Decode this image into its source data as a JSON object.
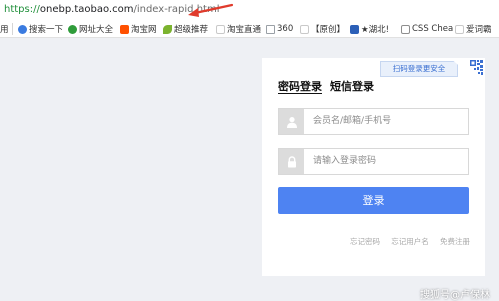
{
  "address_bar": {
    "scheme": "https://",
    "host": "onebp.taobao.com",
    "path": "/index-rapid.html"
  },
  "bookmarks": [
    {
      "label": "用",
      "icon": "apps-icon",
      "color": "#5f6368"
    },
    {
      "label": "搜索一下",
      "icon": "search-engine-icon",
      "color": "#3a7be0"
    },
    {
      "label": "网址大全",
      "icon": "site-nav-icon",
      "color": "#2f9c3a"
    },
    {
      "label": "淘宝网",
      "icon": "taobao-icon",
      "color": "#ff5000"
    },
    {
      "label": "超级推荐",
      "icon": "leaf-icon",
      "color": "#7bb32e"
    },
    {
      "label": "淘宝直通",
      "icon": "page-icon",
      "color": "#c9c9c9"
    },
    {
      "label": "360",
      "icon": "folder-icon",
      "color": "#9aa0a6"
    },
    {
      "label": "【原创】",
      "icon": "page-icon",
      "color": "#c9c9c9"
    },
    {
      "label": "★湖北!",
      "icon": "hubei-icon",
      "color": "#2b5fb7"
    },
    {
      "label": "CSS Chea",
      "icon": "css-icon",
      "color": "#8e8e8e"
    },
    {
      "label": "爱词霸",
      "icon": "page-icon",
      "color": "#c9c9c9"
    }
  ],
  "login": {
    "qr_tip": "扫码登录更安全",
    "tabs": [
      "密码登录",
      "短信登录"
    ],
    "username_placeholder": "会员名/邮箱/手机号",
    "password_placeholder": "请输入登录密码",
    "submit_label": "登录",
    "links": [
      "忘记密码",
      "忘记用户名",
      "免费注册"
    ]
  },
  "watermark": "搜狐号@卢保林"
}
